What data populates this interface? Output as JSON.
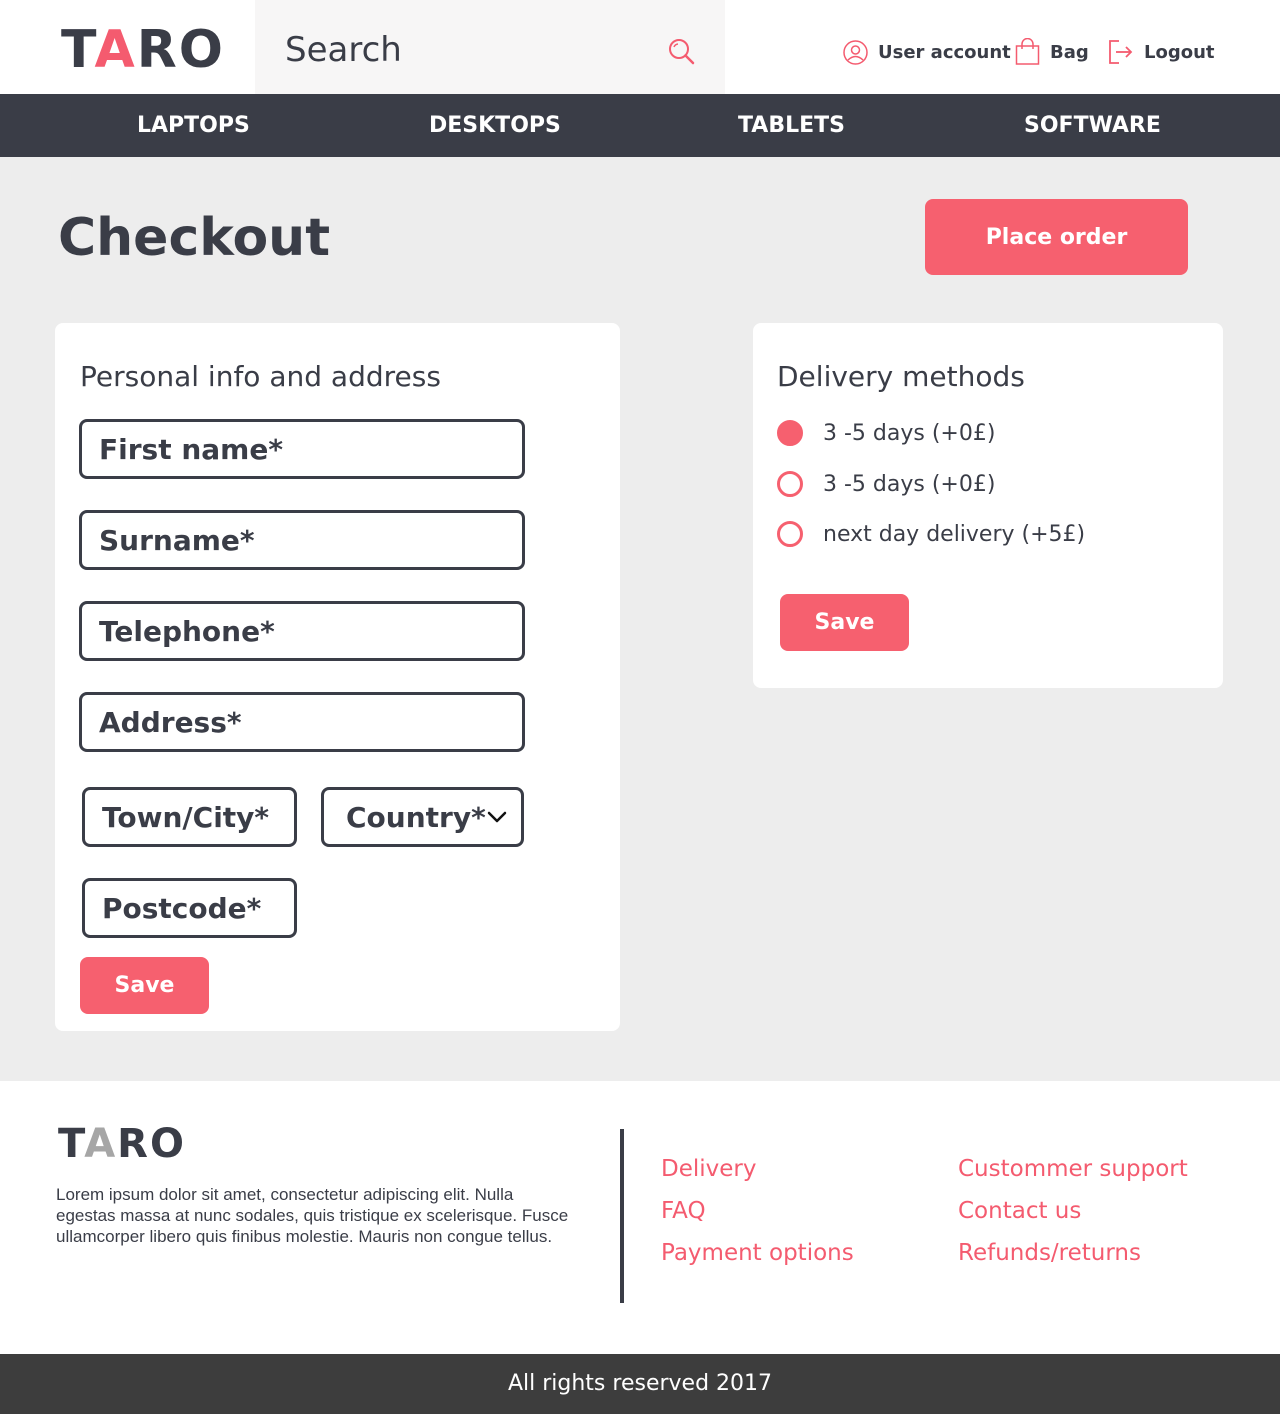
{
  "brand": {
    "logo_parts": [
      "T",
      "A",
      "RO"
    ],
    "accent_color": "#f45b6f",
    "dark_color": "#3a3d47"
  },
  "header": {
    "search_placeholder": "Search",
    "search_icon": "search-icon",
    "links": [
      {
        "label": "User account",
        "icon": "user-icon"
      },
      {
        "label": "Bag",
        "icon": "bag-icon"
      },
      {
        "label": "Logout",
        "icon": "logout-icon"
      }
    ]
  },
  "nav": {
    "items": [
      "LAPTOPS",
      "DESKTOPS",
      "TABLETS",
      "SOFTWARE"
    ]
  },
  "main": {
    "title": "Checkout",
    "place_order_label": "Place order"
  },
  "personal_card": {
    "title": "Personal info and address",
    "fields": {
      "first_name": "First name*",
      "surname": "Surname*",
      "telephone": "Telephone*",
      "address": "Address*",
      "town": "Town/City*",
      "country": "Country*",
      "postcode": "Postcode*"
    },
    "save_label": "Save"
  },
  "delivery_card": {
    "title": "Delivery methods",
    "options": [
      {
        "label": "3 -5 days (+0£)",
        "selected": true
      },
      {
        "label": "3 -5 days (+0£)",
        "selected": false
      },
      {
        "label": "next day delivery (+5£)",
        "selected": false
      }
    ],
    "save_label": "Save"
  },
  "footer": {
    "logo_parts": [
      "T",
      "A",
      "RO"
    ],
    "text": "Lorem ipsum dolor sit amet, consectetur adipiscing elit. Nulla egestas massa at nunc sodales, quis tristique ex scelerisque. Fusce ullamcorper libero quis finibus molestie. Mauris non congue tellus.",
    "links_left": [
      "Delivery",
      "FAQ",
      "Payment options"
    ],
    "links_right": [
      "Custommer support",
      "Contact us",
      "Refunds/returns"
    ],
    "copyright": "All rights reserved 2017"
  }
}
